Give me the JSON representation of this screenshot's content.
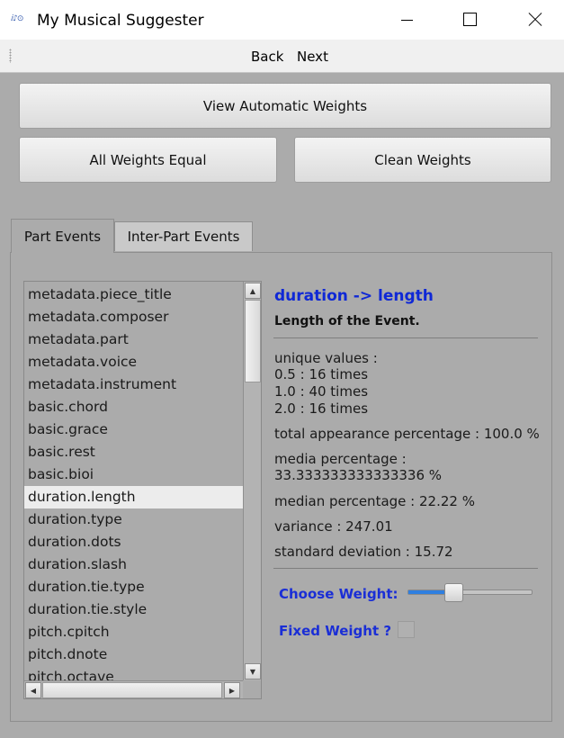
{
  "window": {
    "icon_text": "ⅈ♪⊙",
    "title": "My Musical Suggester"
  },
  "menu": {
    "back": "Back",
    "next": "Next"
  },
  "buttons": {
    "view_automatic": "View Automatic Weights",
    "all_equal": "All Weights Equal",
    "clean": "Clean Weights"
  },
  "tabs": [
    {
      "label": "Part Events",
      "active": true
    },
    {
      "label": "Inter-Part Events",
      "active": false
    }
  ],
  "event_list": {
    "selected": "duration.length",
    "items": [
      "metadata.piece_title",
      "metadata.composer",
      "metadata.part",
      "metadata.voice",
      "metadata.instrument",
      "basic.chord",
      "basic.grace",
      "basic.rest",
      "basic.bioi",
      "duration.length",
      "duration.type",
      "duration.dots",
      "duration.slash",
      "duration.tie.type",
      "duration.tie.style",
      "pitch.cpitch",
      "pitch.dnote",
      "pitch.octave"
    ]
  },
  "detail": {
    "title": "duration -> length",
    "description": "Length of the Event.",
    "unique_values_label": "unique values :",
    "unique_values": [
      "0.5 : 16 times",
      "1.0 : 40 times",
      "2.0 : 16 times"
    ],
    "total_appearance": "total appearance percentage : 100.0 %",
    "media_label": "media percentage :",
    "media_value": "33.333333333333336 %",
    "median": "median percentage : 22.22 %",
    "variance": "variance : 247.01",
    "std_dev": "standard deviation : 15.72"
  },
  "weight": {
    "choose_label": "Choose Weight:",
    "slider_fraction": 0.35,
    "fixed_label": "Fixed Weight ?",
    "fixed_checked": false
  },
  "colors": {
    "detail_title": "#0f28d6",
    "weight_labels": "#1a2ed6",
    "slider_fill": "#2f7fe0",
    "selected_row": "#ececec"
  }
}
